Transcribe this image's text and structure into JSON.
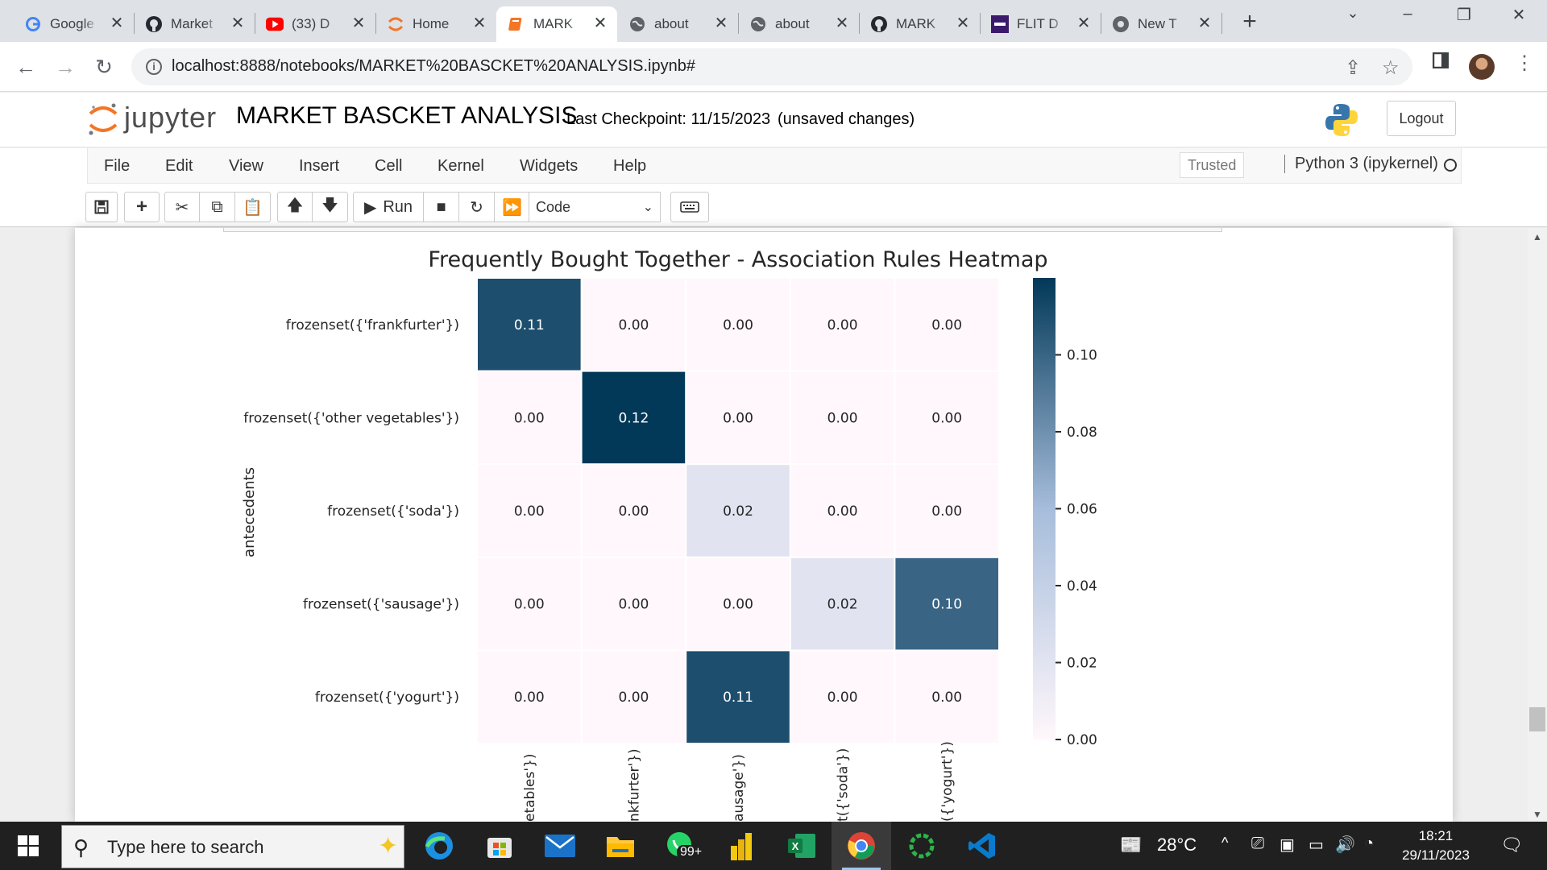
{
  "browser": {
    "tabs": [
      {
        "title": "Google",
        "icon": "google-icon",
        "active": false
      },
      {
        "title": "Market",
        "icon": "github-icon",
        "active": false
      },
      {
        "title": "(33) D",
        "icon": "youtube-icon",
        "active": false
      },
      {
        "title": "Home",
        "icon": "jupyter-icon",
        "active": false
      },
      {
        "title": "MARK",
        "icon": "notebook-icon",
        "active": true
      },
      {
        "title": "about",
        "icon": "globe-icon",
        "active": false
      },
      {
        "title": "about",
        "icon": "globe-icon",
        "active": false
      },
      {
        "title": "MARK",
        "icon": "github-icon",
        "active": false
      },
      {
        "title": "FLIT D",
        "icon": "flit-icon",
        "active": false
      },
      {
        "title": "New T",
        "icon": "chrome-icon",
        "active": false
      }
    ],
    "url": "localhost:8888/notebooks/MARKET%20BASCKET%20ANALYSIS.ipynb#"
  },
  "jupyter": {
    "brand": "jupyter",
    "notebook_title": "MARKET BASCKET ANALYSIS",
    "checkpoint": "Last Checkpoint: 11/15/2023",
    "unsaved": "(unsaved changes)",
    "logout_label": "Logout",
    "menu": [
      "File",
      "Edit",
      "View",
      "Insert",
      "Cell",
      "Kernel",
      "Widgets",
      "Help"
    ],
    "trusted": "Trusted",
    "kernel": "Python 3 (ipykernel)",
    "run_label": "Run",
    "cell_type": "Code"
  },
  "chart_data": {
    "type": "heatmap",
    "title": "Frequently Bought Together - Association Rules Heatmap",
    "ylabel": "antecedents",
    "rows": [
      "frozenset({'frankfurter'})",
      "frozenset({'other vegetables'})",
      "frozenset({'soda'})",
      "frozenset({'sausage'})",
      "frozenset({'yogurt'})"
    ],
    "columns_visible_fragments": [
      "etables'})",
      "nkfurter'})",
      "ausage'})",
      "t({'soda'})",
      "({'yogurt'})"
    ],
    "values": [
      [
        0.11,
        0.0,
        0.0,
        0.0,
        0.0
      ],
      [
        0.0,
        0.12,
        0.0,
        0.0,
        0.0
      ],
      [
        0.0,
        0.0,
        0.02,
        0.0,
        0.0
      ],
      [
        0.0,
        0.0,
        0.0,
        0.02,
        0.1
      ],
      [
        0.0,
        0.0,
        0.11,
        0.0,
        0.0
      ]
    ],
    "colorbar": {
      "range": [
        0,
        0.12
      ],
      "ticks": [
        "0.00",
        "0.02",
        "0.04",
        "0.06",
        "0.08",
        "0.10"
      ],
      "colormap": "PuBu"
    },
    "colors": {
      "low": "#fff7fb",
      "mid": "#a6bddb",
      "high": "#023858"
    }
  },
  "taskbar": {
    "search_placeholder": "Type here to search",
    "whatsapp_badge": "99+",
    "weather": "28°C",
    "time": "18:21",
    "date": "29/11/2023"
  }
}
